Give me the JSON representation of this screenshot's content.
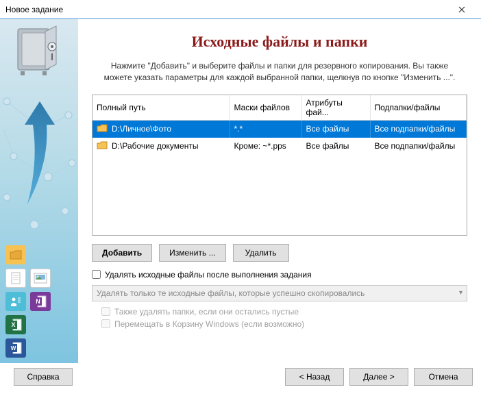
{
  "window": {
    "title": "Новое задание"
  },
  "page": {
    "heading": "Исходные файлы и папки",
    "instruction": "Нажмите \"Добавить\" и выберите файлы и папки для резервного копирования. Вы также можете указать параметры для каждой выбранной папки, щелкнув по кнопке \"Изменить ...\"."
  },
  "table": {
    "headers": {
      "path": "Полный путь",
      "masks": "Маски файлов",
      "attrs": "Атрибуты фай...",
      "sub": "Подпапки/файлы"
    },
    "rows": [
      {
        "path": "D:\\Личное\\Фото",
        "masks": "*.*",
        "attrs": "Все файлы",
        "sub": "Все подпапки/файлы",
        "selected": true
      },
      {
        "path": "D:\\Рабочие документы",
        "masks": "Кроме: ~*.pps",
        "attrs": "Все файлы",
        "sub": "Все подпапки/файлы",
        "selected": false
      }
    ]
  },
  "buttons": {
    "add": "Добавить",
    "edit": "Изменить ...",
    "delete": "Удалить"
  },
  "options": {
    "deleteSource": "Удалять исходные файлы после выполнения задания",
    "dropdownSelected": "Удалять только те исходные файлы, которые успешно скопировались",
    "alsoDeleteFolders": "Также удалять папки, если они остались пустые",
    "moveToRecycle": "Перемещать в Корзину Windows (если возможно)"
  },
  "footer": {
    "help": "Справка",
    "back": "< Назад",
    "next": "Далее >",
    "cancel": "Отмена"
  }
}
